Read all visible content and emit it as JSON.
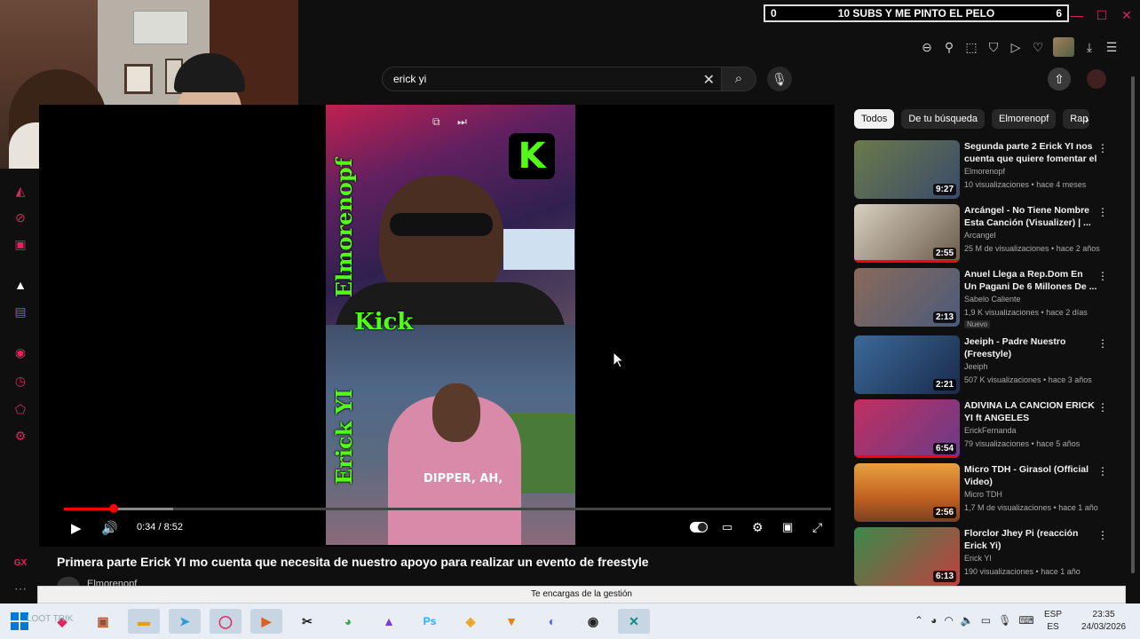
{
  "overlay": {
    "subs_left": "0",
    "subs_text": "10 SUBS Y ME PINTO EL PELO",
    "subs_right": "6"
  },
  "search": {
    "query": "erick yi"
  },
  "video": {
    "labels": {
      "top_vertical": "Elmorenopf",
      "middle": "Kick",
      "bottom_vertical": "Erick YI",
      "shirt_text": "DIPPER, AH,"
    },
    "kick_logo": "K",
    "time": "0:34 / 8:52",
    "progress": 0.065,
    "title": "Primera parte Erick YI mo cuenta que necesita de nuestro apoyo para realizar un evento de freestyle",
    "channel": "Elmorenopf"
  },
  "chips": [
    "Todos",
    "De tu búsqueda",
    "Elmorenopf",
    "Rap"
  ],
  "related": [
    {
      "title": "Segunda parte 2 Erick YI nos cuenta que quiere fomentar el ...",
      "channel": "Elmorenopf",
      "meta": "10 visualizaciones • hace 4 meses",
      "duration": "9:27",
      "badge": ""
    },
    {
      "title": "Arcángel - No Tiene Nombre Esta Canción (Visualizer) | ...",
      "channel": "Arcangel",
      "meta": "25 M de visualizaciones • hace 2 años",
      "duration": "2:55",
      "badge": ""
    },
    {
      "title": "Anuel Llega a Rep.Dom En Un Pagani De 6 Millones De ...",
      "channel": "Sabelo Caliente",
      "meta": "1,9 K visualizaciones • hace 2 días",
      "duration": "2:13",
      "badge": "Nuevo"
    },
    {
      "title": "Jeeiph - Padre Nuestro (Freestyle)",
      "channel": "Jeeiph",
      "meta": "507 K visualizaciones • hace 3 años",
      "duration": "2:21",
      "badge": ""
    },
    {
      "title": "ADIVINA LA CANCION ERICK YI ft ANGELES",
      "channel": "ErickFernanda",
      "meta": "79 visualizaciones • hace 5 años",
      "duration": "6:54",
      "badge": ""
    },
    {
      "title": "Micro TDH - Girasol (Official Video)",
      "channel": "Micro TDH",
      "meta": "1,7 M de visualizaciones • hace 1 año",
      "duration": "2:56",
      "badge": ""
    },
    {
      "title": "Florclor Jhey Pi (reacción Erick Yi)",
      "channel": "Erick YI",
      "meta": "190 visualizaciones • hace 1 año",
      "duration": "6:13",
      "badge": ""
    }
  ],
  "notification": "Te encargas de la gestión",
  "taskbar": {
    "lang_top": "ESP",
    "lang_bottom": "ES",
    "time": "23:35",
    "date": "24/03/2026",
    "faint_text": "LOOT TRIK"
  },
  "sidebar_bottom_label": "GX",
  "colors": {
    "accent": "#e0245e",
    "kick_green": "#53fc18",
    "progress_red": "#ff0000"
  }
}
